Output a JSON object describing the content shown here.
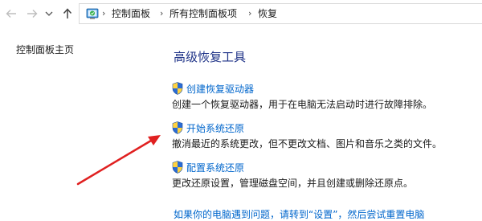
{
  "addressbar": {
    "breadcrumbs": [
      "控制面板",
      "所有控制面板项",
      "恢复"
    ],
    "separator": "›"
  },
  "sidebar": {
    "home_link": "控制面板主页"
  },
  "main": {
    "title": "高级恢复工具",
    "tools": [
      {
        "label": "创建恢复驱动器",
        "description": "创建一个恢复驱动器，用于在电脑无法启动时进行故障排除。"
      },
      {
        "label": "开始系统还原",
        "description": "撤消最近的系统更改，但不更改文档、图片和音乐之类的文件。"
      },
      {
        "label": "配置系统还原",
        "description": "更改还原设置，管理磁盘空间，并且创建或删除还原点。"
      }
    ],
    "bottom_link": "如果你的电脑遇到问题，请转到“设置”，然后尝试重置电脑"
  },
  "colors": {
    "title": "#1e3287",
    "link": "#0066cc",
    "annotation_arrow": "#e02020"
  },
  "icons": [
    "back-arrow-icon",
    "forward-arrow-icon",
    "recent-locations-chevron-icon",
    "up-arrow-icon",
    "control-panel-icon",
    "uac-shield-icon"
  ]
}
